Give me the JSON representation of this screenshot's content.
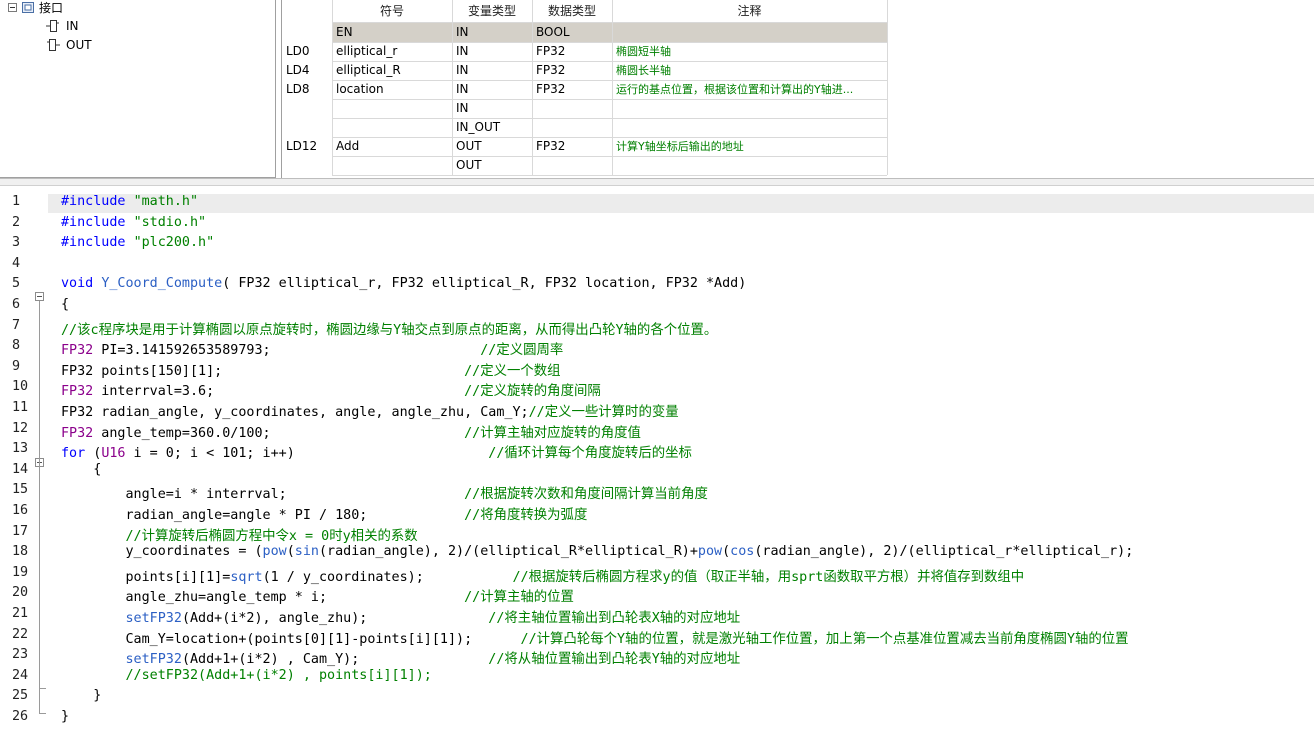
{
  "tree": {
    "root_label": "接口",
    "children": [
      "IN",
      "OUT"
    ]
  },
  "var_table": {
    "headers": [
      "符号",
      "变量类型",
      "数据类型",
      "注释"
    ],
    "rows": [
      {
        "addr": "",
        "symbol": "EN",
        "var_type": "IN",
        "data_type": "BOOL",
        "comment": "",
        "highlight": true
      },
      {
        "addr": "LD0",
        "symbol": "elliptical_r",
        "var_type": "IN",
        "data_type": "FP32",
        "comment": "椭圆短半轴"
      },
      {
        "addr": "LD4",
        "symbol": "elliptical_R",
        "var_type": "IN",
        "data_type": "FP32",
        "comment": "椭圆长半轴"
      },
      {
        "addr": "LD8",
        "symbol": "location",
        "var_type": "IN",
        "data_type": "FP32",
        "comment": "运行的基点位置，根据该位置和计算出的Y轴进..."
      },
      {
        "addr": "",
        "symbol": "",
        "var_type": "IN",
        "data_type": "",
        "comment": ""
      },
      {
        "addr": "",
        "symbol": "",
        "var_type": "IN_OUT",
        "data_type": "",
        "comment": ""
      },
      {
        "addr": "LD12",
        "symbol": "Add",
        "var_type": "OUT",
        "data_type": "FP32",
        "comment": "计算Y轴坐标后输出的地址"
      },
      {
        "addr": "",
        "symbol": "",
        "var_type": "OUT",
        "data_type": "",
        "comment": ""
      }
    ],
    "colors": {
      "highlight_row": "#d4d0c8",
      "comment_text": "#008000"
    }
  },
  "code": {
    "line_numbers": [
      "1",
      "2",
      "3",
      "4",
      "5",
      "6",
      "7",
      "8",
      "9",
      "10",
      "11",
      "12",
      "13",
      "14",
      "15",
      "16",
      "17",
      "18",
      "19",
      "20",
      "21",
      "22",
      "23",
      "24",
      "25",
      "26"
    ],
    "lines": [
      [
        [
          "kw",
          "#include "
        ],
        [
          "str",
          "\"math.h\""
        ]
      ],
      [
        [
          "kw",
          "#include "
        ],
        [
          "str",
          "\"stdio.h\""
        ]
      ],
      [
        [
          "kw",
          "#include "
        ],
        [
          "str",
          "\"plc200.h\""
        ]
      ],
      [],
      [
        [
          "kw",
          "void "
        ],
        [
          "fn",
          "Y_Coord_Compute"
        ],
        [
          "tx",
          "( FP32 elliptical_r, FP32 elliptical_R, FP32 location, FP32 *Add)"
        ]
      ],
      [
        [
          "tx",
          "{"
        ]
      ],
      [
        [
          "cm",
          "//该c程序块是用于计算椭圆以原点旋转时，椭圆边缘与Y轴交点到原点的距离，从而得出凸轮Y轴的各个位置。"
        ]
      ],
      [
        [
          "ty",
          "FP32"
        ],
        [
          "tx",
          " PI=3.141592653589793;                          "
        ],
        [
          "cm",
          "//定义圆周率"
        ]
      ],
      [
        [
          "tx",
          "FP32 points[150][1];                              "
        ],
        [
          "cm",
          "//定义一个数组"
        ]
      ],
      [
        [
          "ty",
          "FP32"
        ],
        [
          "tx",
          " interrval=3.6;                               "
        ],
        [
          "cm",
          "//定义旋转的角度间隔"
        ]
      ],
      [
        [
          "tx",
          "FP32 radian_angle, y_coordinates, angle, angle_zhu, Cam_Y;"
        ],
        [
          "cm",
          "//定义一些计算时的变量"
        ]
      ],
      [
        [
          "ty",
          "FP32"
        ],
        [
          "tx",
          " angle_temp=360.0/100;                        "
        ],
        [
          "cm",
          "//计算主轴对应旋转的角度值"
        ]
      ],
      [
        [
          "kw",
          "for"
        ],
        [
          "tx",
          " ("
        ],
        [
          "ty",
          "U16"
        ],
        [
          "tx",
          " i = 0; i < 101; i++)                        "
        ],
        [
          "cm",
          "//循环计算每个角度旋转后的坐标"
        ]
      ],
      [
        [
          "tx",
          "    {"
        ]
      ],
      [
        [
          "tx",
          "        angle=i * interrval;                      "
        ],
        [
          "cm",
          "//根据旋转次数和角度间隔计算当前角度"
        ]
      ],
      [
        [
          "tx",
          "        radian_angle=angle * PI / 180;            "
        ],
        [
          "cm",
          "//将角度转换为弧度"
        ]
      ],
      [
        [
          "tx",
          "        "
        ],
        [
          "cm",
          "//计算旋转后椭圆方程中令x = 0时y相关的系数"
        ]
      ],
      [
        [
          "tx",
          "        y_coordinates = ("
        ],
        [
          "fn",
          "pow"
        ],
        [
          "tx",
          "("
        ],
        [
          "fn",
          "sin"
        ],
        [
          "tx",
          "(radian_angle), 2)/(elliptical_R*elliptical_R)+"
        ],
        [
          "fn",
          "pow"
        ],
        [
          "tx",
          "("
        ],
        [
          "fn",
          "cos"
        ],
        [
          "tx",
          "(radian_angle), 2)/(elliptical_r*elliptical_r);"
        ]
      ],
      [
        [
          "tx",
          "        points[i][1]="
        ],
        [
          "fn",
          "sqrt"
        ],
        [
          "tx",
          "(1 / y_coordinates);           "
        ],
        [
          "cm",
          "//根据旋转后椭圆方程求y的值（取正半轴，用sprt函数取平方根）并将值存到数组中"
        ]
      ],
      [
        [
          "tx",
          "        angle_zhu=angle_temp * i;                 "
        ],
        [
          "cm",
          "//计算主轴的位置"
        ]
      ],
      [
        [
          "tx",
          "        "
        ],
        [
          "fn",
          "setFP32"
        ],
        [
          "tx",
          "(Add+(i*2), angle_zhu);               "
        ],
        [
          "cm",
          "//将主轴位置输出到凸轮表X轴的对应地址"
        ]
      ],
      [
        [
          "tx",
          "        Cam_Y=location+(points[0][1]-points[i][1]);      "
        ],
        [
          "cm",
          "//计算凸轮每个Y轴的位置，就是激光轴工作位置，加上第一个点基准位置减去当前角度椭圆Y轴的位置"
        ]
      ],
      [
        [
          "tx",
          "        "
        ],
        [
          "fn",
          "setFP32"
        ],
        [
          "tx",
          "(Add+1+(i*2) , Cam_Y);                "
        ],
        [
          "cm",
          "//将从轴位置输出到凸轮表Y轴的对应地址"
        ]
      ],
      [
        [
          "tx",
          "        "
        ],
        [
          "cm",
          "//setFP32(Add+1+(i*2) , points[i][1]);"
        ]
      ],
      [
        [
          "tx",
          "    }"
        ]
      ],
      [
        [
          "tx",
          "}"
        ]
      ]
    ],
    "colors": {
      "keyword": "#0000ff",
      "type": "#8b008b",
      "function": "#2b5fc4",
      "string": "#008000",
      "comment": "#008000",
      "current_line": "#ececec"
    }
  }
}
